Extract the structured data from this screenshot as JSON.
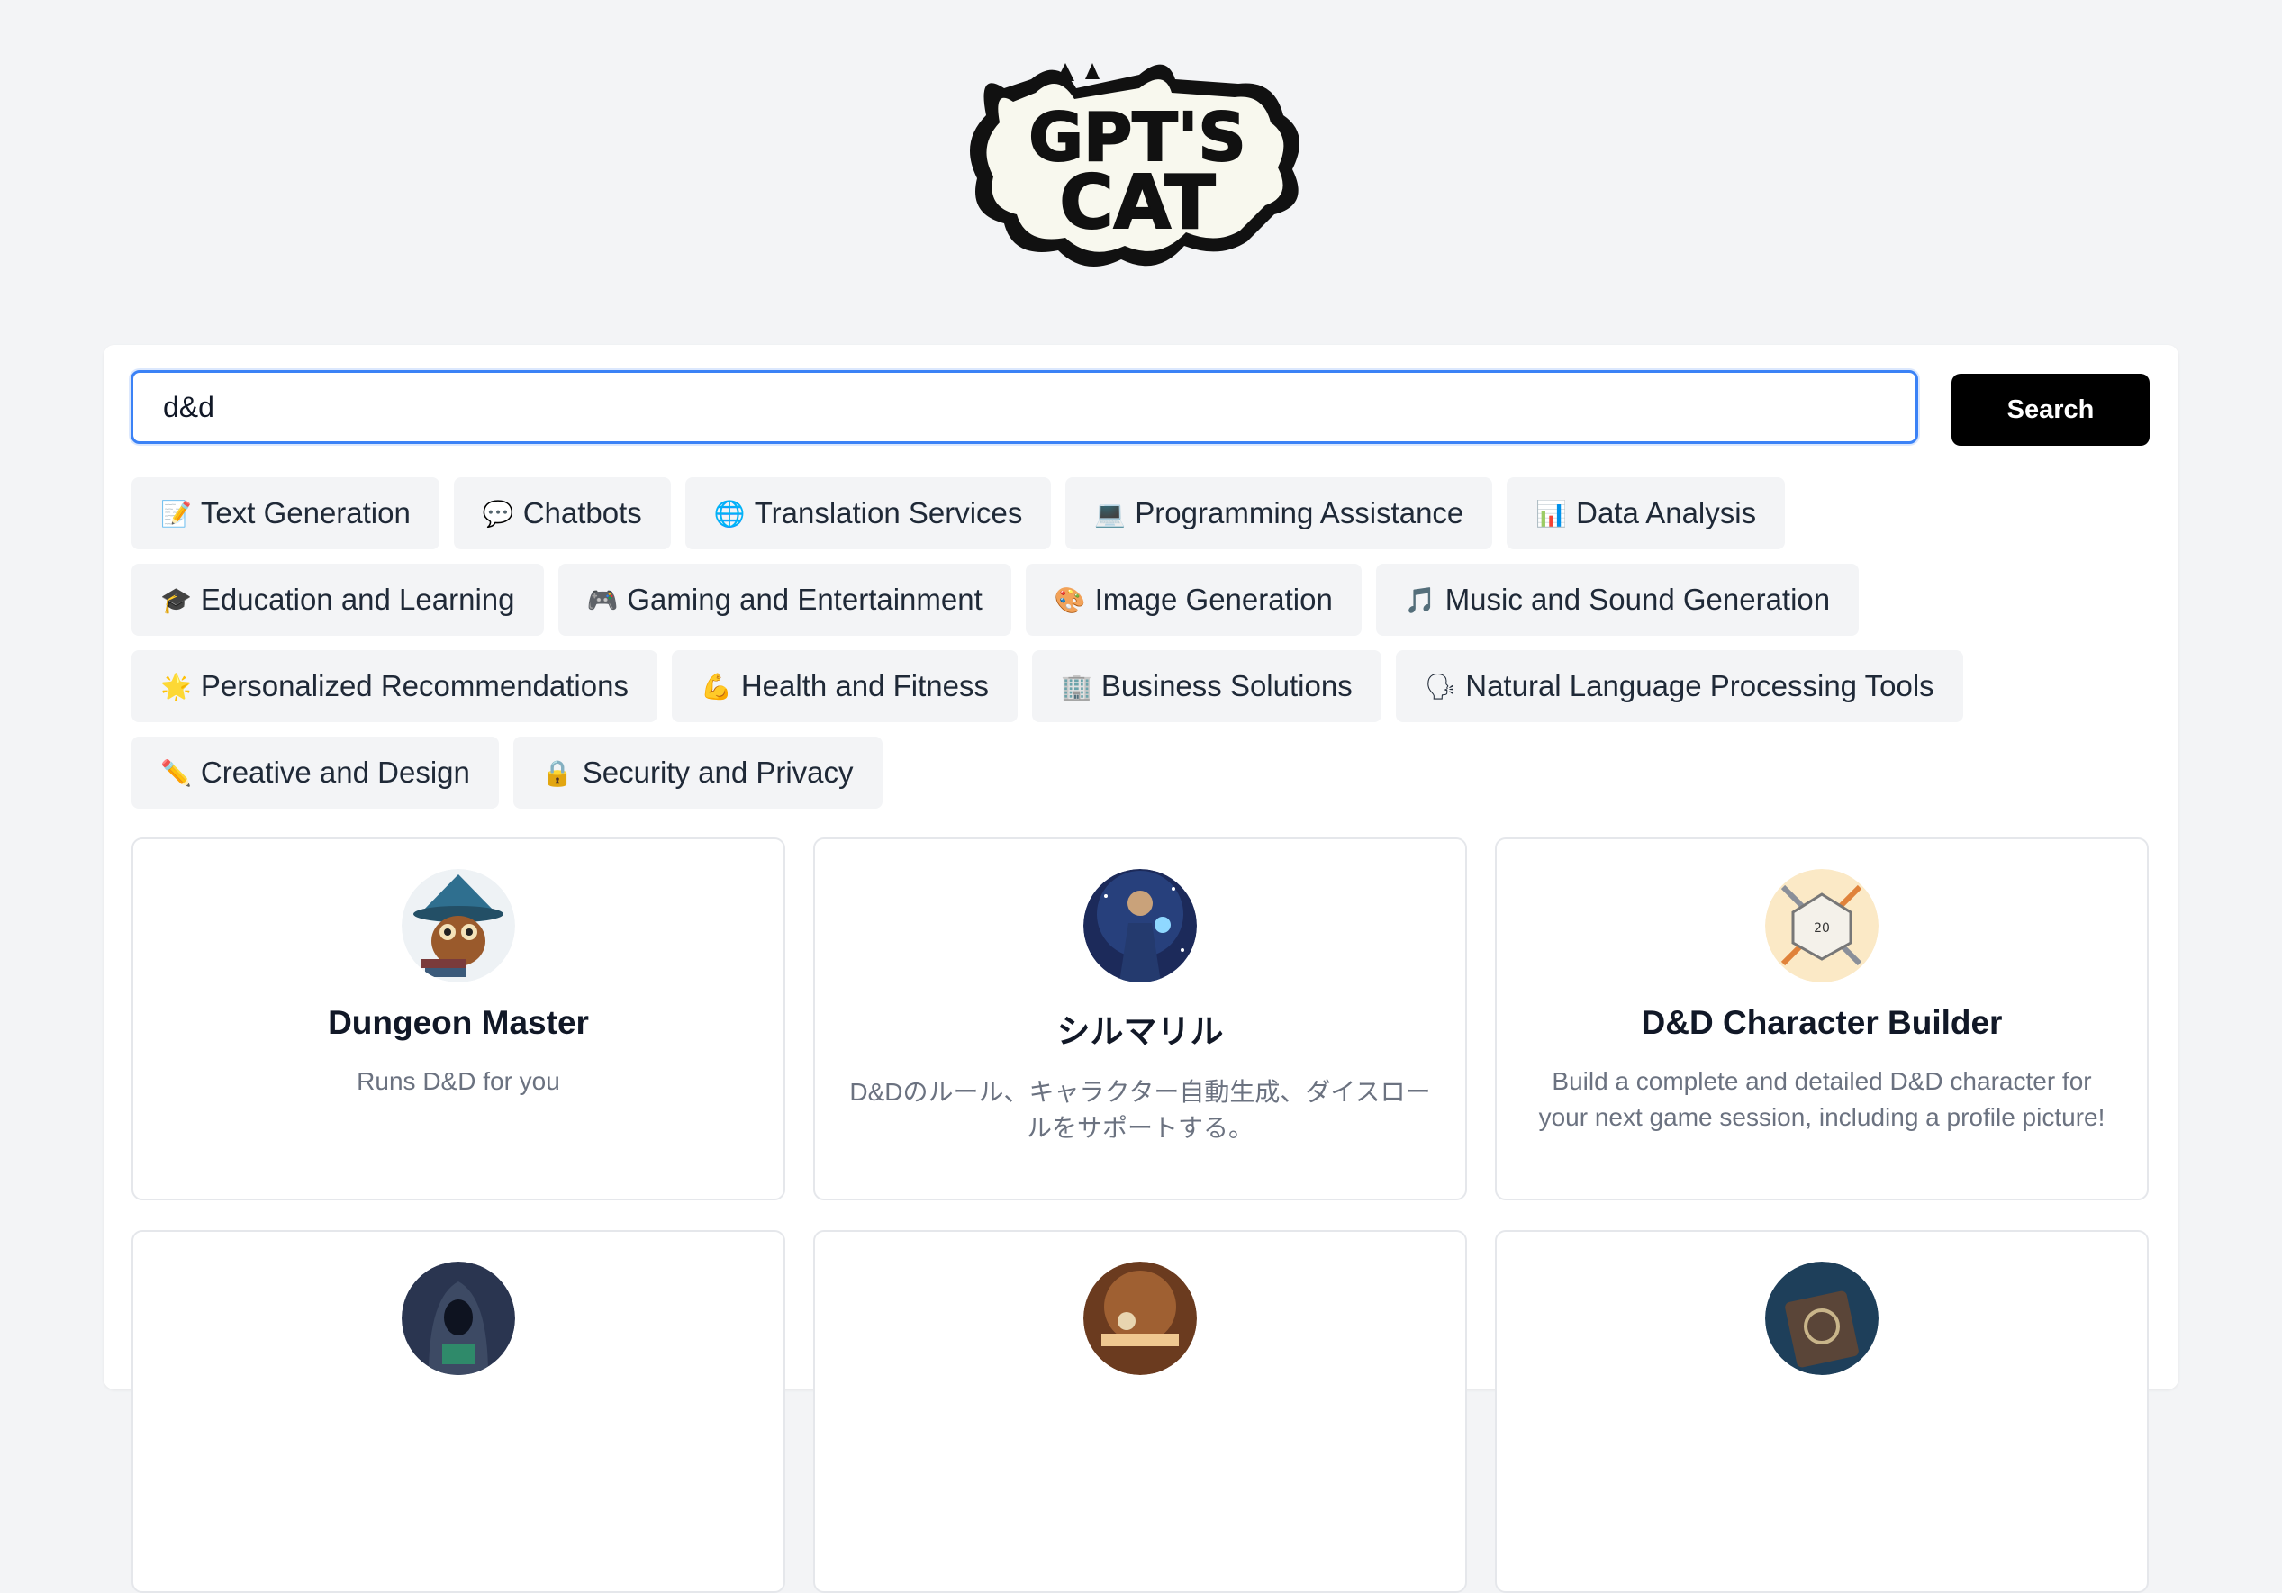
{
  "logo": {
    "line1": "GPT'S",
    "line2": "CAT"
  },
  "search": {
    "value": "d&d",
    "button_label": "Search"
  },
  "categories": [
    {
      "icon": "memo-icon",
      "glyph": "📝",
      "label": "Text Generation"
    },
    {
      "icon": "speech-bubble-icon",
      "glyph": "💬",
      "label": "Chatbots"
    },
    {
      "icon": "globe-icon",
      "glyph": "🌐",
      "label": "Translation Services"
    },
    {
      "icon": "laptop-icon",
      "glyph": "💻",
      "label": "Programming Assistance"
    },
    {
      "icon": "bar-chart-icon",
      "glyph": "📊",
      "label": "Data Analysis"
    },
    {
      "icon": "graduation-cap-icon",
      "glyph": "🎓",
      "label": "Education and Learning"
    },
    {
      "icon": "game-controller-icon",
      "glyph": "🎮",
      "label": "Gaming and Entertainment"
    },
    {
      "icon": "palette-icon",
      "glyph": "🎨",
      "label": "Image Generation"
    },
    {
      "icon": "music-note-icon",
      "glyph": "🎵",
      "label": "Music and Sound Generation"
    },
    {
      "icon": "sparkle-icon",
      "glyph": "🌟",
      "label": "Personalized Recommendations"
    },
    {
      "icon": "flexed-biceps-icon",
      "glyph": "💪",
      "label": "Health and Fitness"
    },
    {
      "icon": "office-building-icon",
      "glyph": "🏢",
      "label": "Business Solutions"
    },
    {
      "icon": "speaking-head-icon",
      "glyph": "🗣",
      "label": "Natural Language Processing Tools"
    },
    {
      "icon": "pencil-icon",
      "glyph": "✏️",
      "label": "Creative and Design"
    },
    {
      "icon": "lock-icon",
      "glyph": "🔒",
      "label": "Security and Privacy"
    }
  ],
  "results": [
    {
      "title": "Dungeon Master",
      "description": "Runs D&D for you",
      "avatar": "owl-wizard-avatar"
    },
    {
      "title": "シルマリル",
      "description": "D&Dのルール、キャラクター自動生成、ダイスロールをサポートする。",
      "avatar": "mage-avatar"
    },
    {
      "title": "D&D Character Builder",
      "description": "Build a complete and detailed D&D character for your next game session, including a profile picture!",
      "avatar": "d20-sword-avatar"
    },
    {
      "title": "",
      "description": "",
      "avatar": "hooded-figure-avatar"
    },
    {
      "title": "",
      "description": "",
      "avatar": "tavern-table-avatar"
    },
    {
      "title": "",
      "description": "",
      "avatar": "spellbook-avatar"
    }
  ],
  "colors": {
    "accent": "#3b82f6",
    "button": "#000000",
    "chip_bg": "#f3f4f6"
  }
}
